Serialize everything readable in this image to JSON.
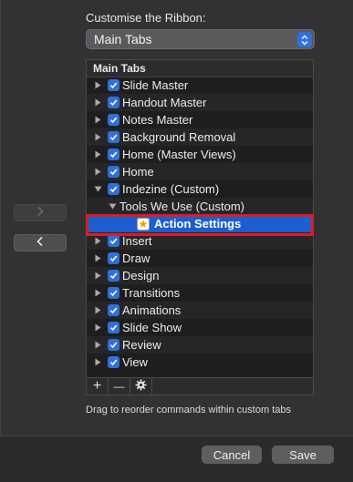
{
  "ribbon": {
    "label": "Customise the Ribbon:",
    "selected": "Main Tabs"
  },
  "move_buttons": {
    "right_icon": "chevron-right-icon",
    "left_icon": "chevron-left-icon"
  },
  "tree": {
    "header": "Main Tabs",
    "rows": [
      {
        "label": "Slide Master",
        "expanded": false,
        "checked": true
      },
      {
        "label": "Handout Master",
        "expanded": false,
        "checked": true
      },
      {
        "label": "Notes Master",
        "expanded": false,
        "checked": true
      },
      {
        "label": "Background Removal",
        "expanded": false,
        "checked": true
      },
      {
        "label": "Home (Master Views)",
        "expanded": false,
        "checked": true
      },
      {
        "label": "Home",
        "expanded": false,
        "checked": true
      },
      {
        "label": "Indezine (Custom)",
        "expanded": true,
        "checked": true
      },
      {
        "label": "Tools We Use (Custom)",
        "expanded": true,
        "checked": null
      },
      {
        "label": "Action Settings",
        "selected": true,
        "icon": "star-icon"
      },
      {
        "label": "Insert",
        "expanded": false,
        "checked": true
      },
      {
        "label": "Draw",
        "expanded": false,
        "checked": true
      },
      {
        "label": "Design",
        "expanded": false,
        "checked": true
      },
      {
        "label": "Transitions",
        "expanded": false,
        "checked": true
      },
      {
        "label": "Animations",
        "expanded": false,
        "checked": true
      },
      {
        "label": "Slide Show",
        "expanded": false,
        "checked": true
      },
      {
        "label": "Review",
        "expanded": false,
        "checked": true
      },
      {
        "label": "View",
        "expanded": false,
        "checked": true
      }
    ]
  },
  "footer": {
    "add": "+",
    "remove": "—",
    "settings_icon": "gear-icon"
  },
  "hint": "Drag to reorder commands within custom tabs",
  "buttons": {
    "cancel": "Cancel",
    "save": "Save"
  },
  "colors": {
    "accent": "#2f6fe0",
    "selection": "#1a5fd1",
    "highlight": "#e01b22"
  }
}
